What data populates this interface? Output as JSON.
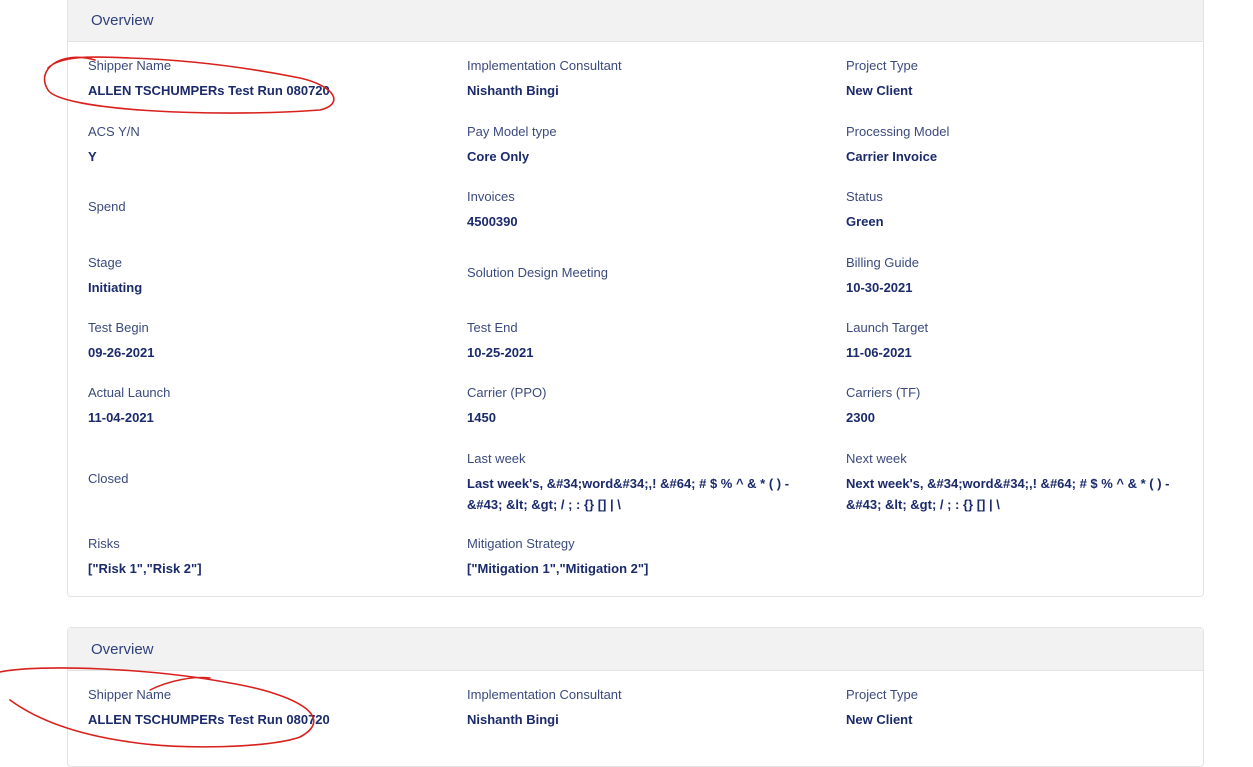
{
  "cards": [
    {
      "title": "Overview",
      "fields": {
        "shipper_name": {
          "label": "Shipper Name",
          "value": "ALLEN TSCHUMPERs Test Run 080720"
        },
        "implementation_consultant": {
          "label": "Implementation Consultant",
          "value": "Nishanth Bingi"
        },
        "project_type": {
          "label": "Project Type",
          "value": "New Client"
        },
        "acs": {
          "label": "ACS Y/N",
          "value": "Y"
        },
        "pay_model_type": {
          "label": "Pay Model type",
          "value": "Core Only"
        },
        "processing_model": {
          "label": "Processing Model",
          "value": "Carrier Invoice"
        },
        "spend": {
          "label": "Spend",
          "value": ""
        },
        "invoices": {
          "label": "Invoices",
          "value": "4500390"
        },
        "status": {
          "label": "Status",
          "value": "Green"
        },
        "stage": {
          "label": "Stage",
          "value": "Initiating"
        },
        "solution_design_meeting": {
          "label": "Solution Design Meeting",
          "value": ""
        },
        "billing_guide": {
          "label": "Billing Guide",
          "value": "10-30-2021"
        },
        "test_begin": {
          "label": "Test Begin",
          "value": "09-26-2021"
        },
        "test_end": {
          "label": "Test End",
          "value": "10-25-2021"
        },
        "launch_target": {
          "label": "Launch Target",
          "value": "11-06-2021"
        },
        "actual_launch": {
          "label": "Actual Launch",
          "value": "11-04-2021"
        },
        "carrier_ppo": {
          "label": "Carrier (PPO)",
          "value": "1450"
        },
        "carriers_tf": {
          "label": "Carriers (TF)",
          "value": "2300"
        },
        "closed": {
          "label": "Closed",
          "value": ""
        },
        "last_week": {
          "label": "Last week",
          "value": "Last week's, &#34;word&#34;,! &#64; # $ % ^ & * ( ) - &#43; &lt; &gt; / ; : {} [] | \\"
        },
        "next_week": {
          "label": "Next week",
          "value": "Next week's, &#34;word&#34;,! &#64; # $ % ^ & * ( ) - &#43; &lt; &gt; / ; : {} [] | \\"
        },
        "risks": {
          "label": "Risks",
          "value": "[\"Risk 1\",\"Risk 2\"]"
        },
        "mitigation_strategy": {
          "label": "Mitigation Strategy",
          "value": "[\"Mitigation 1\",\"Mitigation 2\"]"
        }
      }
    },
    {
      "title": "Overview",
      "fields": {
        "shipper_name": {
          "label": "Shipper Name",
          "value": "ALLEN TSCHUMPERs Test Run 080720"
        },
        "implementation_consultant": {
          "label": "Implementation Consultant",
          "value": "Nishanth Bingi"
        },
        "project_type": {
          "label": "Project Type",
          "value": "New Client"
        }
      }
    }
  ],
  "colors": {
    "annotation_ink": "#d8201c",
    "value_text": "#1b2a6b",
    "header_bg": "#f2f2f2"
  }
}
